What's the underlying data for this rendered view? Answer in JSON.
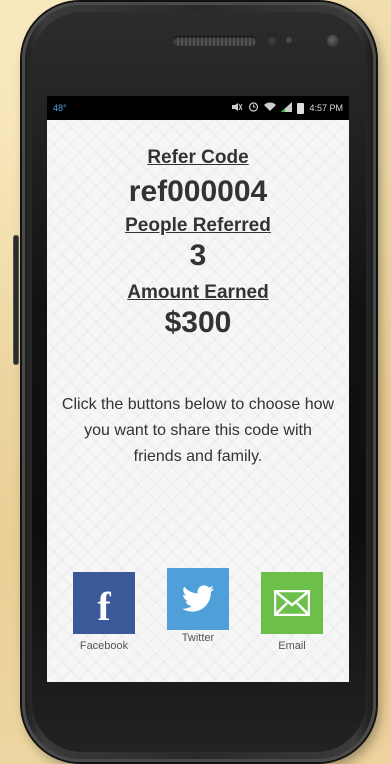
{
  "status_bar": {
    "left_text": "48°",
    "time": "4:57 PM"
  },
  "refer": {
    "label": "Refer Code",
    "value": "ref000004"
  },
  "people": {
    "label": "People Referred",
    "value": "3"
  },
  "amount": {
    "label": "Amount Earned",
    "value": "$300"
  },
  "instructions": "Click the buttons below to choose how you want to share this code with friends and family.",
  "share": [
    {
      "label": "Facebook",
      "icon": "facebook-icon",
      "color": "#3b5998"
    },
    {
      "label": "Twitter",
      "icon": "twitter-bird-icon",
      "color": "#4f9fd9"
    },
    {
      "label": "Email",
      "icon": "envelope-icon",
      "color": "#6cc04a"
    }
  ]
}
